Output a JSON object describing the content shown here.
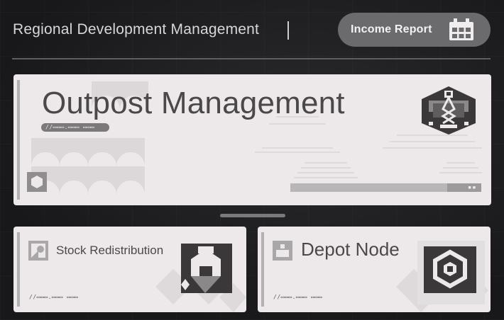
{
  "header": {
    "title": "Regional Development Management",
    "income_button_label": "Income Report"
  },
  "main_card": {
    "title": "Outpost Management",
    "code": "//▭▭▭.▭▭▭ ▭▭▭",
    "progress": 0.82
  },
  "stock_card": {
    "title": "Stock Redistribution",
    "code": "//▭▭▭.▭▭▭ ▭▭▭"
  },
  "depot_card": {
    "title": "Depot Node",
    "code": "//▭▭▭.▭▭▭ ▭▭▭"
  },
  "colors": {
    "background": "#1d1d1f",
    "card": "#ede9ea",
    "button": "#6b6b6d",
    "emblem_dark": "#3a3839",
    "emblem_mid": "#8a8889"
  }
}
